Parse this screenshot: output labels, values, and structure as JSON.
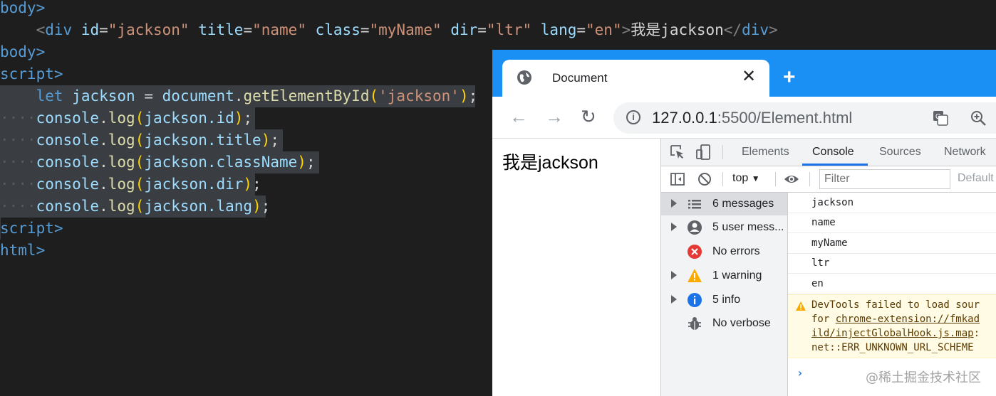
{
  "editor": {
    "line1": "body>",
    "line2": {
      "open": "div",
      "attrs": [
        {
          "name": "id",
          "value": "\"jackson\""
        },
        {
          "name": "title",
          "value": "\"name\""
        },
        {
          "name": "class",
          "value": "\"myName\""
        },
        {
          "name": "dir",
          "value": "\"ltr\""
        },
        {
          "name": "lang",
          "value": "\"en\""
        }
      ],
      "text": "我是jackson",
      "close": "div"
    },
    "line3": "body>",
    "line4": "script>",
    "line5": {
      "kw": "let",
      "var": "jackson",
      "eq": "=",
      "obj": "document",
      "fn": "getElementById",
      "arg": "'jackson'"
    },
    "logs": [
      {
        "obj": "console",
        "fn": "log",
        "arg": "jackson.id"
      },
      {
        "obj": "console",
        "fn": "log",
        "arg": "jackson.title"
      },
      {
        "obj": "console",
        "fn": "log",
        "arg": "jackson.className"
      },
      {
        "obj": "console",
        "fn": "log",
        "arg": "jackson.dir"
      },
      {
        "obj": "console",
        "fn": "log",
        "arg": "jackson.lang"
      }
    ],
    "line11": "script>",
    "line12": "html>"
  },
  "browser": {
    "tab_title": "Document",
    "url_host": "127.0.0.1",
    "url_rest": ":5500/Element.html",
    "page_text": "我是jackson"
  },
  "devtools": {
    "tabs": [
      "Elements",
      "Console",
      "Sources",
      "Network"
    ],
    "active_tab": "Console",
    "context": "top",
    "filter_placeholder": "Filter",
    "levels": "Default",
    "sidebar": [
      {
        "label": "6 messages",
        "icon": "list-icon",
        "arrow": true,
        "selected": true
      },
      {
        "label": "5 user mess...",
        "icon": "user-icon",
        "arrow": true
      },
      {
        "label": "No errors",
        "icon": "error-icon",
        "arrow": false
      },
      {
        "label": "1 warning",
        "icon": "warning-icon",
        "arrow": true
      },
      {
        "label": "5 info",
        "icon": "info-icon",
        "arrow": true
      },
      {
        "label": "No verbose",
        "icon": "bug-icon",
        "arrow": false
      }
    ],
    "messages": [
      "jackson",
      "name",
      "myName",
      "ltr",
      "en"
    ],
    "warning": {
      "line1": "DevTools failed to load sour",
      "line2_prefix": "for ",
      "line2_link": "chrome-extension://fmkad",
      "line3_link": "ild/injectGlobalHook.js.map",
      "line3_suffix": ":",
      "line4": "net::ERR_UNKNOWN_URL_SCHEME"
    },
    "prompt": "›"
  },
  "watermark": "@稀土掘金技术社区",
  "colors": {
    "tabstrip": "#1a90f5",
    "editor_bg": "#1e1e1e",
    "accent": "#1a73e8"
  }
}
